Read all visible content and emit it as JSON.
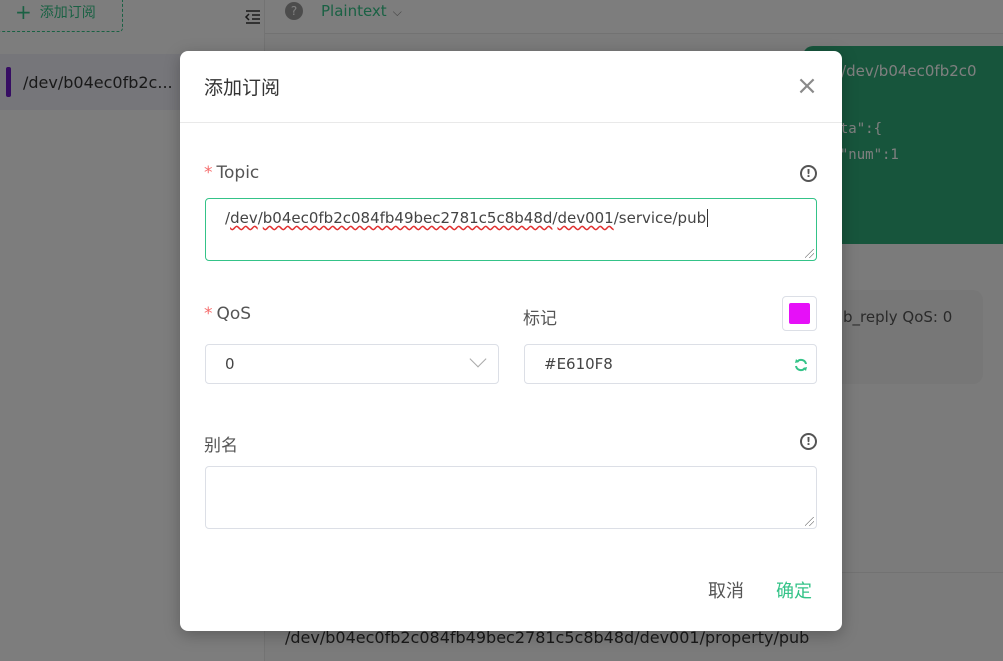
{
  "sidebar": {
    "add_subscription_label": "添加订阅",
    "subscriptions": [
      {
        "topic": "/dev/b04ec0fb2c...",
        "color": "#6D1BC6"
      }
    ]
  },
  "main": {
    "payload_type": "Plaintext",
    "messages": {
      "received_topic": "c: /dev/b04ec0fb2c0",
      "received_payload": "data\":{\n  \"num\":1",
      "sent_meta": "b_reply   QoS: 0"
    },
    "publish_topic": "/dev/b04ec0fb2c084fb49bec2781c5c8b48d/dev001/property/pub"
  },
  "dialog": {
    "title": "添加订阅",
    "topic": {
      "label": "Topic",
      "value_parts": [
        "/",
        "dev",
        "/",
        "b04ec0fb2c084fb49bec2781c5c8b48d",
        "/",
        "dev001",
        "/service/pub"
      ]
    },
    "qos": {
      "label": "QoS",
      "value": "0"
    },
    "mark": {
      "label": "标记",
      "value": "#E610F8",
      "color": "#E610F8"
    },
    "alias": {
      "label": "别名",
      "value": ""
    },
    "cancel_label": "取消",
    "confirm_label": "确定"
  },
  "colors": {
    "accent": "#34C388",
    "required": "#F56C6C"
  }
}
